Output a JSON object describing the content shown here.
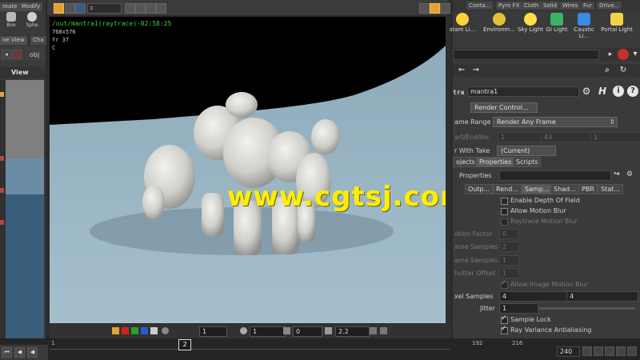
{
  "left": {
    "tabs": [
      "reate",
      "Modify"
    ],
    "tools": [
      {
        "label": "Box",
        "icon": "box-icon"
      },
      {
        "label": "Sphe",
        "icon": "sphere-icon"
      }
    ],
    "pane_tabs": [
      "ne View",
      "Cha"
    ],
    "path_label": "obj",
    "view_label": "View"
  },
  "viewport": {
    "camera": "c",
    "title": "/out/mantra1(raytrace)-02:58:25",
    "resolution": "768x576",
    "fr": "fr 37",
    "c": "C",
    "watermark": "www.cgtsj.com",
    "bottom": {
      "field1": "1",
      "field2": "0",
      "field3": "2.2"
    },
    "timeline": {
      "start": "1",
      "current_frame": "2"
    }
  },
  "right": {
    "shelf_tabs": [
      "Conta...",
      "Pyro FX",
      "Cloth",
      "Solid",
      "Wires",
      "Fur",
      "Drive..."
    ],
    "tools": [
      {
        "label": "stant Li...",
        "icon": "constant-light-icon"
      },
      {
        "label": "Environm...",
        "icon": "environment-light-icon"
      },
      {
        "label": "Sky Light",
        "icon": "sky-light-icon"
      },
      {
        "label": "GI Light",
        "icon": "gi-light-icon"
      },
      {
        "label": "Caustic Li...",
        "icon": "caustic-light-icon"
      },
      {
        "label": "Portal Light",
        "icon": "portal-light-icon"
      }
    ],
    "node_type": "tra",
    "node_name": "mantra1",
    "render_control_label": "Render Control...",
    "frame_range_label": "ame Range",
    "frame_range_value": "Render Any Frame",
    "start_end_label": "art/End/Inc",
    "start_end_values": [
      "1",
      "43",
      "1"
    ],
    "render_with_take_label": "r With Take",
    "render_with_take_value": "(Current)",
    "tabs": [
      "ojects",
      "Properties",
      "Scripts"
    ],
    "properties_label": "Properties",
    "subtabs": [
      "Outp...",
      "Rend...",
      "Samp...",
      "Shad...",
      "PBR",
      "Stat..."
    ],
    "options": {
      "dof": "Enable Depth Of Field",
      "motion_blur": "Allow Motion Blur",
      "raytrace_mb": "Raytrace Motion Blur",
      "motion_factor_label": "otion Factor",
      "motion_factor": "0",
      "xform_samples_label": "ame Samples",
      "xform_samples": "2",
      "geo_samples_label": "ame Samples",
      "geo_samples": "1",
      "shutter_offset_label": "hutter Offset",
      "shutter_offset": "1",
      "image_mb": "Allow Image Motion Blur",
      "pixel_samples_label": "xel Samples",
      "pixel_samples": [
        "4",
        "4"
      ],
      "jitter_label": "Jitter",
      "jitter": "1",
      "sample_lock": "Sample Lock",
      "ray_variance": "Ray Variance Antialiasing"
    },
    "timeline": {
      "tick1": "192",
      "tick2": "216",
      "end": "240"
    }
  }
}
